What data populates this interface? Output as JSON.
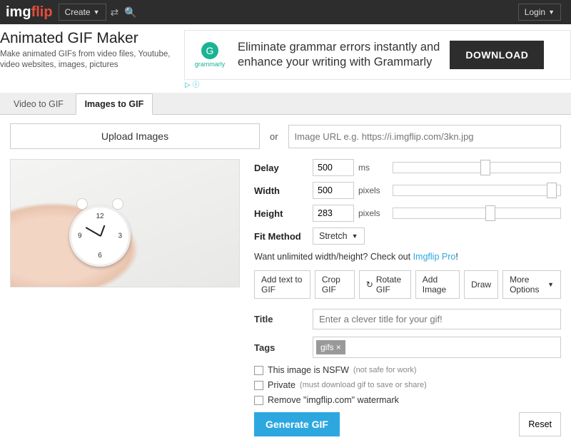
{
  "nav": {
    "create": "Create",
    "login": "Login"
  },
  "header": {
    "title": "Animated GIF Maker",
    "subtitle": "Make animated GIFs from video files, Youtube, video websites, images, pictures"
  },
  "ad": {
    "brand": "grammarly",
    "line1": "Eliminate grammar errors instantly and",
    "line2": "enhance your writing with Grammarly",
    "cta": "DOWNLOAD"
  },
  "tabs": {
    "video": "Video to GIF",
    "images": "Images to GIF"
  },
  "upload": {
    "button": "Upload Images",
    "or": "or",
    "url_placeholder": "Image URL e.g. https://i.imgflip.com/3kn.jpg"
  },
  "fields": {
    "delay": {
      "label": "Delay",
      "value": "500",
      "unit": "ms",
      "thumb_pct": 52
    },
    "width": {
      "label": "Width",
      "value": "500",
      "unit": "pixels",
      "thumb_pct": 92
    },
    "height": {
      "label": "Height",
      "value": "283",
      "unit": "pixels",
      "thumb_pct": 55
    },
    "fit": {
      "label": "Fit Method",
      "value": "Stretch"
    }
  },
  "note": {
    "text": "Want unlimited width/height? Check out ",
    "link": "Imgflip Pro",
    "excl": "!"
  },
  "tools": {
    "addtext": "Add text to GIF",
    "crop": "Crop GIF",
    "rotate": "Rotate GIF",
    "addimg": "Add Image",
    "draw": "Draw",
    "more": "More Options"
  },
  "meta": {
    "title_label": "Title",
    "title_placeholder": "Enter a clever title for your gif!",
    "tags_label": "Tags",
    "tag": "gifs"
  },
  "checks": {
    "nsfw": "This image is NSFW",
    "nsfw_hint": "(not safe for work)",
    "private": "Private",
    "private_hint": "(must download gif to save or share)",
    "watermark": "Remove \"imgflip.com\" watermark"
  },
  "actions": {
    "generate": "Generate GIF",
    "reset": "Reset"
  }
}
